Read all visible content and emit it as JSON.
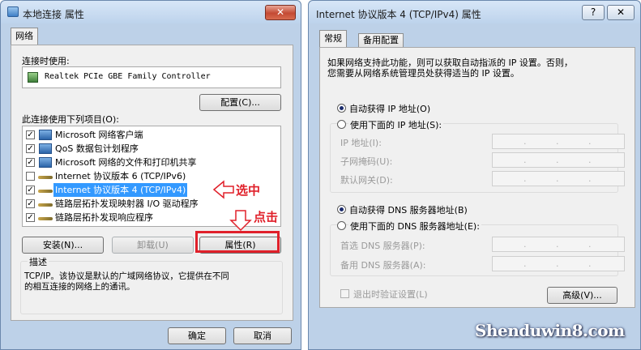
{
  "left_dialog": {
    "title": "本地连接 属性",
    "close_glyph": "✕",
    "tab": "网络",
    "connect_using_label": "连接时使用:",
    "adapter": "Realtek PCIe GBE Family Controller",
    "configure_button": "配置(C)...",
    "items_label": "此连接使用下列项目(O):",
    "items": [
      {
        "label": "Microsoft 网络客户端",
        "checked": true,
        "icon": "network-client-icon"
      },
      {
        "label": "QoS 数据包计划程序",
        "checked": true,
        "icon": "qos-icon"
      },
      {
        "label": "Microsoft 网络的文件和打印机共享",
        "checked": true,
        "icon": "file-share-icon"
      },
      {
        "label": "Internet 协议版本 6 (TCP/IPv6)",
        "checked": false,
        "icon": "protocol-icon"
      },
      {
        "label": "Internet 协议版本 4 (TCP/IPv4)",
        "checked": true,
        "icon": "protocol-icon",
        "selected": true
      },
      {
        "label": "链路层拓扑发现映射器 I/O 驱动程序",
        "checked": true,
        "icon": "protocol-icon"
      },
      {
        "label": "链路层拓扑发现响应程序",
        "checked": true,
        "icon": "protocol-icon"
      }
    ],
    "install_button": "安装(N)...",
    "uninstall_button": "卸载(U)",
    "properties_button": "属性(R)",
    "description_label": "描述",
    "description_text_1": "TCP/IP。该协议是默认的广域网络协议，它提供在不同",
    "description_text_2": "的相互连接的网络上的通讯。",
    "ok_button": "确定",
    "cancel_button": "取消",
    "annotation_select": "选中",
    "annotation_click": "点击"
  },
  "right_dialog": {
    "title": "Internet 协议版本 4 (TCP/IPv4) 属性",
    "help_glyph": "?",
    "close_glyph": "✕",
    "tabs": [
      {
        "label": "常规"
      },
      {
        "label": "备用配置"
      }
    ],
    "intro_1": "如果网络支持此功能，则可以获取自动指派的 IP 设置。否则，",
    "intro_2": "您需要从网络系统管理员处获得适当的 IP 设置。",
    "ip_auto": "自动获得 IP 地址(O)",
    "ip_manual": "使用下面的 IP 地址(S):",
    "ip_address_label": "IP 地址(I):",
    "subnet_label": "子网掩码(U):",
    "gateway_label": "默认网关(D):",
    "dns_auto": "自动获得 DNS 服务器地址(B)",
    "dns_manual": "使用下面的 DNS 服务器地址(E):",
    "preferred_dns_label": "首选 DNS 服务器(P):",
    "alternate_dns_label": "备用 DNS 服务器(A):",
    "validate_label": "退出时验证设置(L)",
    "advanced_button": "高级(V)...",
    "ip_dot": "."
  },
  "watermark": "Shenduwin8.com"
}
